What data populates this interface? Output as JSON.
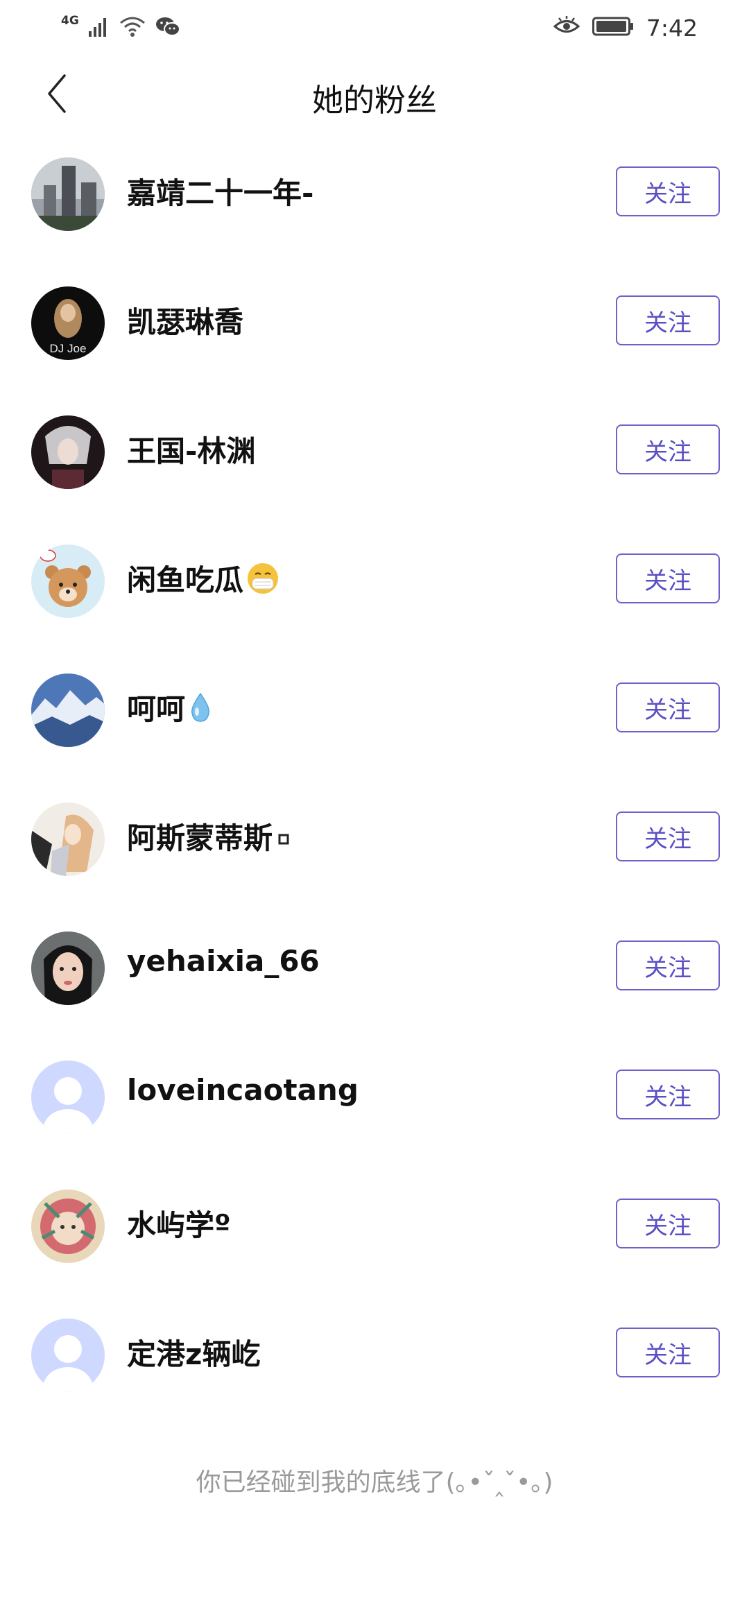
{
  "status_bar": {
    "network": "4G",
    "time": "7:42"
  },
  "nav": {
    "title": "她的粉丝"
  },
  "followers": [
    {
      "name": "嘉靖二十一年-",
      "suffix_icon": "",
      "avatar": "city-tower-photo",
      "follow_label": "关注"
    },
    {
      "name": "凯瑟琳喬",
      "suffix_icon": "",
      "avatar": "dj-joe-portrait",
      "follow_label": "关注"
    },
    {
      "name": "王国-林渊",
      "suffix_icon": "",
      "avatar": "anime-silver-hair",
      "follow_label": "关注"
    },
    {
      "name": "闲鱼吃瓜",
      "suffix_icon": "mask-face-emoji",
      "avatar": "cartoon-bear",
      "follow_label": "关注"
    },
    {
      "name": "呵呵",
      "suffix_icon": "droplet-emoji",
      "avatar": "snow-mountains",
      "follow_label": "关注"
    },
    {
      "name": "阿斯蒙蒂斯",
      "suffix_icon": "small-square",
      "avatar": "fantasy-angel",
      "follow_label": "关注"
    },
    {
      "name": "yehaixia_66",
      "suffix_icon": "",
      "avatar": "woman-selfie",
      "follow_label": "关注"
    },
    {
      "name": "loveincaotang",
      "suffix_icon": "",
      "avatar": "default-avatar",
      "follow_label": "关注"
    },
    {
      "name": "水屿学º",
      "suffix_icon": "",
      "avatar": "colorful-illustration",
      "follow_label": "关注"
    },
    {
      "name": "定港z辆屹",
      "suffix_icon": "",
      "avatar": "default-avatar",
      "follow_label": "关注"
    }
  ],
  "footer": {
    "end_text": "你已经碰到我的底线了(｡•ˇ‸ˇ•｡)"
  },
  "colors": {
    "accent": "#5a4fc4",
    "default_avatar_bg": "#cfd9ff"
  }
}
